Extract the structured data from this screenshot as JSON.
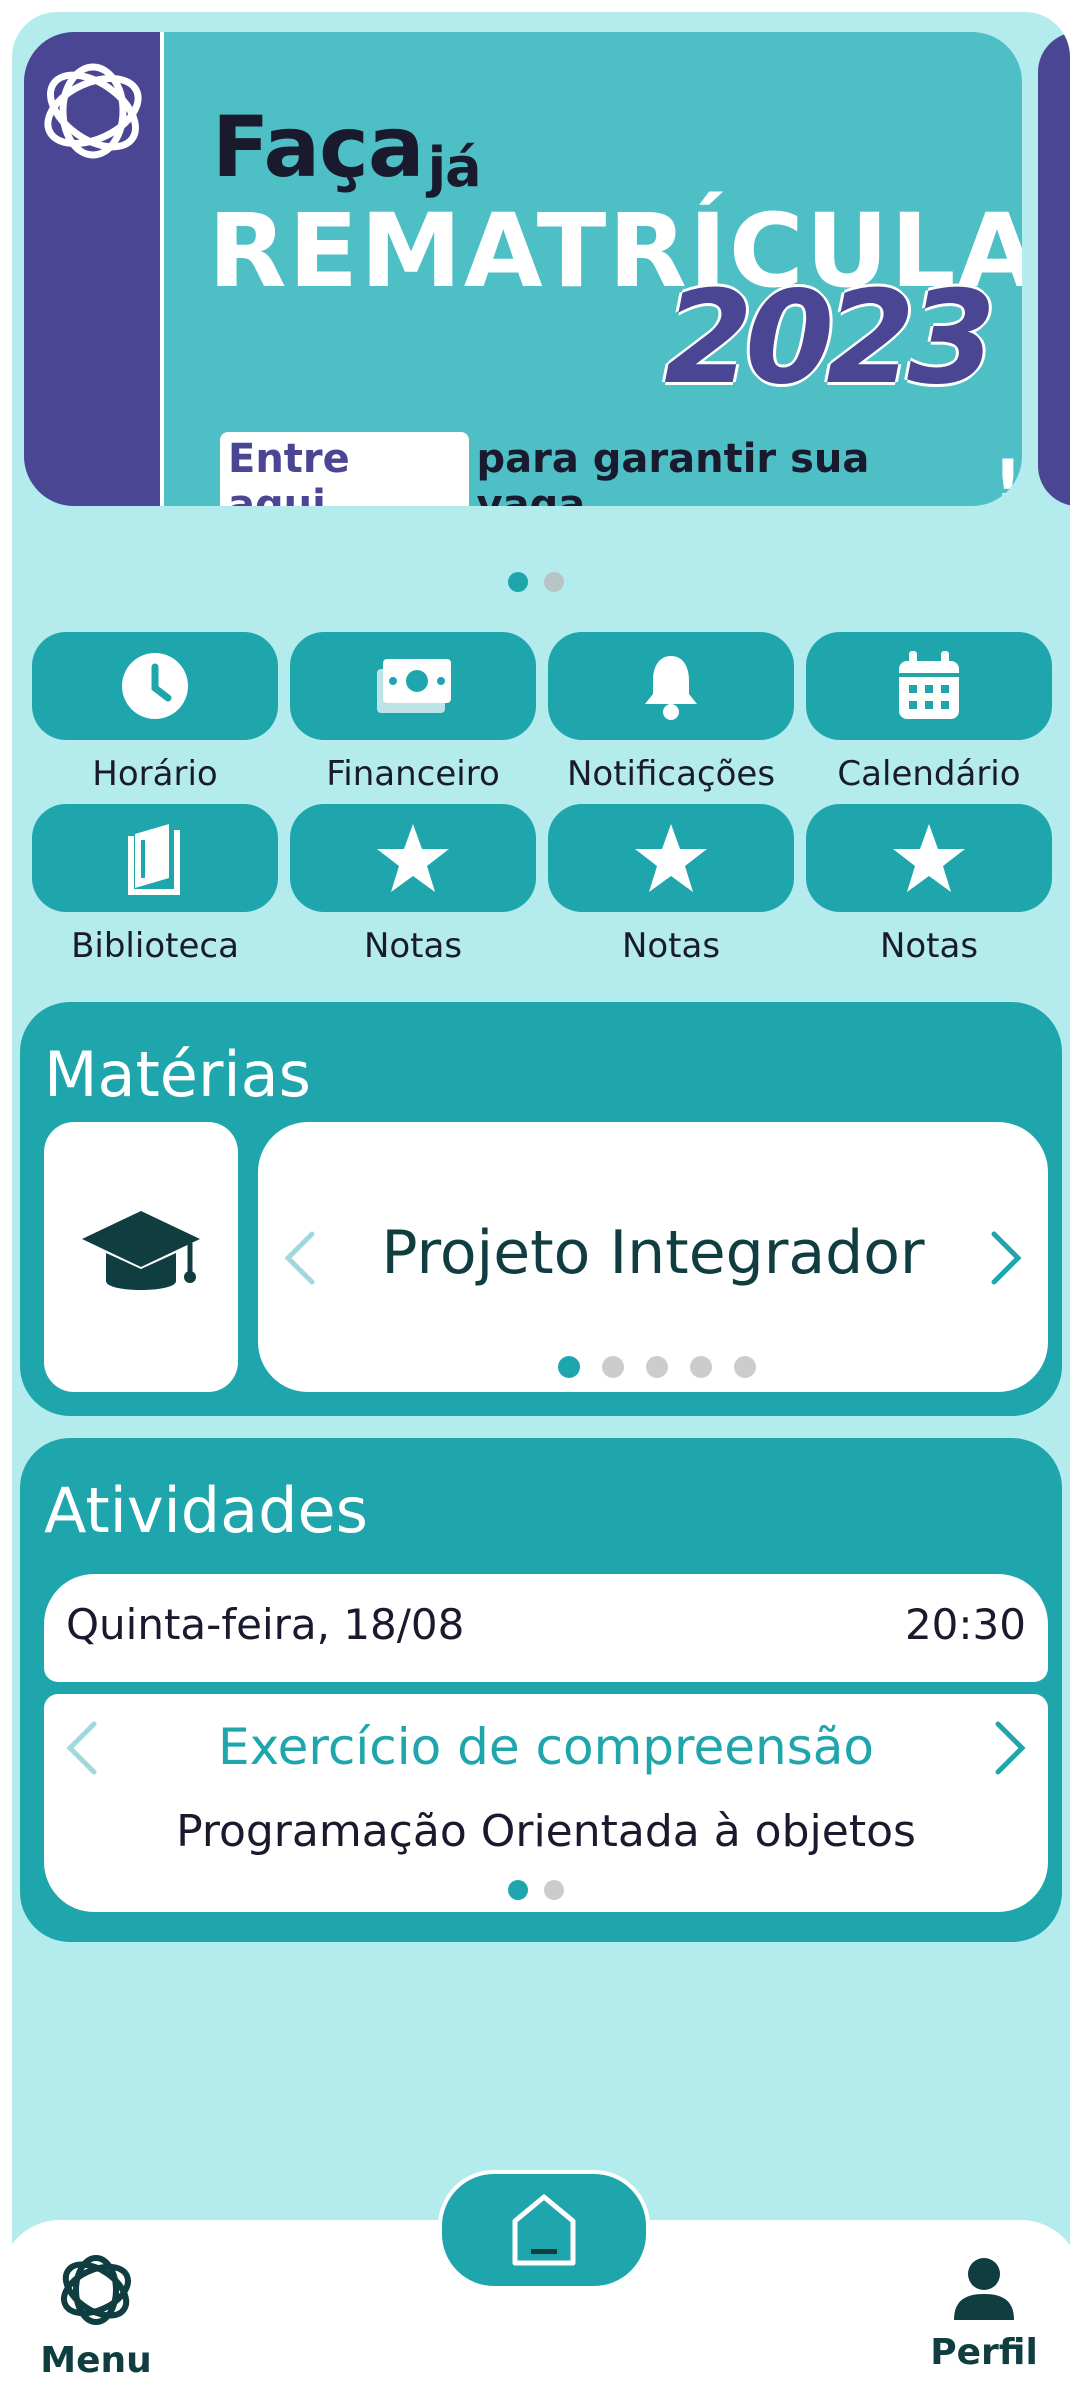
{
  "banner": {
    "line1": "Faça",
    "line1_small": "já",
    "line2": "REMATRÍCULA",
    "year": "2023",
    "cta_highlight": "Entre aqui",
    "cta_rest": "para garantir sua vaga",
    "cta_exclaim": "!",
    "carousel_page": 1,
    "carousel_total": 2
  },
  "quick_actions": [
    {
      "label": "Horário",
      "icon": "clock-icon"
    },
    {
      "label": "Financeiro",
      "icon": "money-icon"
    },
    {
      "label": "Notificações",
      "icon": "bell-icon"
    },
    {
      "label": "Calendário",
      "icon": "calendar-icon"
    },
    {
      "label": "Biblioteca",
      "icon": "book-icon"
    },
    {
      "label": "Notas",
      "icon": "star-icon"
    },
    {
      "label": "Notas",
      "icon": "star-icon"
    },
    {
      "label": "Notas",
      "icon": "star-icon"
    }
  ],
  "materias": {
    "title": "Matérias",
    "icon": "graduation-cap-icon",
    "current": "Projeto Integrador",
    "page": 1,
    "total": 5
  },
  "atividades": {
    "title": "Atividades",
    "date": "Quinta-feira, 18/08",
    "time": "20:30",
    "activity_title": "Exercício de compreensão",
    "activity_subject": "Programação Orientada à objetos",
    "page": 1,
    "total": 2
  },
  "bottom_nav": {
    "menu_label": "Menu",
    "perfil_label": "Perfil",
    "home_icon": "home-icon"
  },
  "colors": {
    "background": "#b4ecee",
    "primary": "#1fa6ad",
    "banner_teal": "#4fbfc6",
    "banner_purple": "#4a4694",
    "dark_text": "#0f3d40"
  }
}
